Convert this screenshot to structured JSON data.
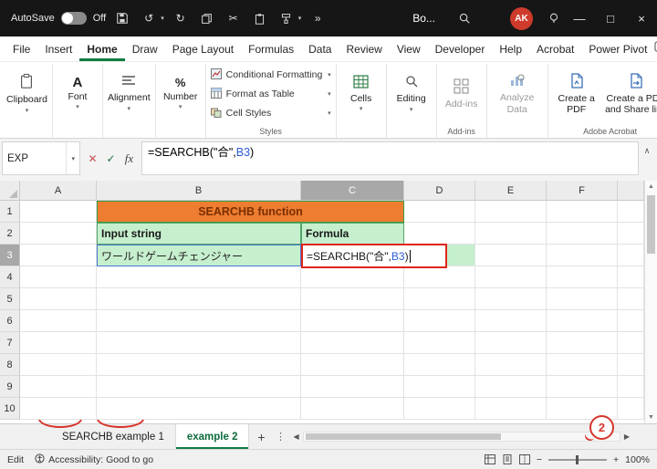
{
  "titlebar": {
    "autosave_label": "AutoSave",
    "autosave_state": "Off",
    "workbook_name": "Bo...",
    "avatar_initials": "AK"
  },
  "menubar": {
    "items": [
      "File",
      "Insert",
      "Home",
      "Draw",
      "Page Layout",
      "Formulas",
      "Data",
      "Review",
      "View",
      "Developer",
      "Help",
      "Acrobat",
      "Power Pivot"
    ],
    "active": "Home"
  },
  "ribbon": {
    "clipboard": "Clipboard",
    "font": "Font",
    "alignment": "Alignment",
    "number": "Number",
    "styles_items": [
      "Conditional Formatting",
      "Format as Table",
      "Cell Styles"
    ],
    "styles_group": "Styles",
    "cells": "Cells",
    "editing": "Editing",
    "addins": "Add-ins",
    "addins_group": "Add-ins",
    "analyze": "Analyze Data",
    "pdf_create": "Create a PDF",
    "pdf_share": "Create a PDF and Share link",
    "acrobat_group": "Adobe Acrobat"
  },
  "formula_bar": {
    "name_box": "EXP",
    "fx": "fx",
    "formula_prefix": "=SEARCHB(\"合\",",
    "formula_ref": "B3",
    "formula_suffix": ")"
  },
  "grid": {
    "columns": [
      "A",
      "B",
      "C",
      "D",
      "E",
      "F"
    ],
    "rows": [
      "1",
      "2",
      "3",
      "4",
      "5",
      "6",
      "7",
      "8",
      "9",
      "10"
    ],
    "table": {
      "title": "SEARCHB function",
      "col1_header": "Input string",
      "col2_header": "Formula",
      "input_value": "ワールドゲームチェンジャー",
      "formula_prefix": "=SEARCHB(\"合\",",
      "formula_ref": "B3",
      "formula_suffix": ")"
    }
  },
  "sheet_tabs": {
    "tab1": "SEARCHB example 1",
    "tab2": "example 2",
    "active": "example 2"
  },
  "status_bar": {
    "mode": "Edit",
    "accessibility": "Accessibility: Good to go",
    "zoom": "100%"
  },
  "annotation": {
    "number": "2"
  },
  "icons": {
    "close": "×",
    "minimize": "—",
    "maximize": "□",
    "chevron_down": "▾",
    "chevron_up": "∧",
    "cancel": "✕",
    "enter": "✓",
    "add_sheet": "+",
    "tab_splitter": "⋮",
    "scroll_left": "◀",
    "scroll_right": "▶",
    "scroll_up": "▲",
    "scroll_down": "▼",
    "undo": "↺",
    "redo": "↻",
    "cut": "✂",
    "overflow": "»",
    "zoom_out": "−",
    "zoom_in": "+"
  },
  "colors": {
    "excel_green": "#107C41",
    "table_orange": "#ED7D31",
    "cell_green": "#C6EFCE",
    "annotation_red": "#D6352B",
    "reference_blue": "#2B5DD7",
    "titlebar_bg": "#161616"
  }
}
